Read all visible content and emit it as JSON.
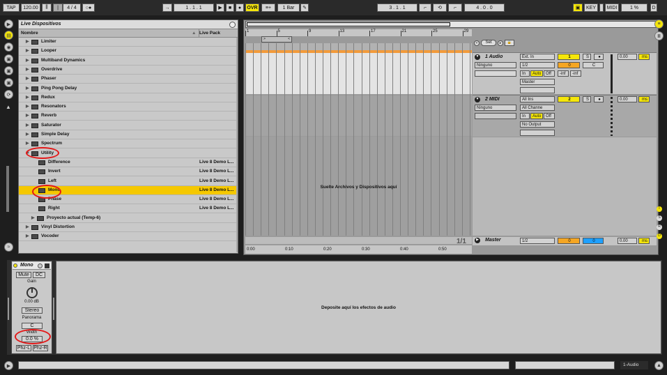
{
  "transport": {
    "tap": "TAP",
    "tempo": "120.00",
    "signature": "4 / 4",
    "arrangement_pos": "1 .  1 .  1",
    "ovr": "OVR",
    "quantize": "1 Bar",
    "loop_start": "3 .  1 .  1",
    "loop_length": "4 .  0 .  0",
    "key": "KEY",
    "midi": "MIDI",
    "cpu": "1 %",
    "disk": "D"
  },
  "browser": {
    "title": "Live Dispositivos",
    "col_name": "Nombre",
    "col_pack": "Live Pack",
    "rows": [
      {
        "name": "Limiter",
        "pack": ""
      },
      {
        "name": "Looper",
        "pack": ""
      },
      {
        "name": "Multiband Dynamics",
        "pack": ""
      },
      {
        "name": "Overdrive",
        "pack": ""
      },
      {
        "name": "Phaser",
        "pack": ""
      },
      {
        "name": "Ping Pong Delay",
        "pack": ""
      },
      {
        "name": "Redux",
        "pack": ""
      },
      {
        "name": "Resonators",
        "pack": ""
      },
      {
        "name": "Reverb",
        "pack": ""
      },
      {
        "name": "Saturator",
        "pack": ""
      },
      {
        "name": "Simple Delay",
        "pack": ""
      },
      {
        "name": "Spectrum",
        "pack": ""
      },
      {
        "name": "Utility",
        "pack": ""
      },
      {
        "name": "Difference",
        "pack": "Live 8 Demo L..."
      },
      {
        "name": "Invert",
        "pack": "Live 8 Demo L..."
      },
      {
        "name": "Left",
        "pack": "Live 8 Demo L..."
      },
      {
        "name": "Mono",
        "pack": "Live 8 Demo L..."
      },
      {
        "name": "Phase",
        "pack": "Live 8 Demo L..."
      },
      {
        "name": "Right",
        "pack": "Live 8 Demo L..."
      },
      {
        "name": "Proyecto actual (Temp-6)",
        "pack": ""
      },
      {
        "name": "Vinyl Distortion",
        "pack": ""
      },
      {
        "name": "Vocoder",
        "pack": ""
      }
    ]
  },
  "arrangement": {
    "bar_numbers": [
      "1",
      "5",
      "9",
      "13",
      "17",
      "21",
      "25",
      "29"
    ],
    "time_labels": [
      "0:00",
      "0:10",
      "0:20",
      "0:30",
      "0:40",
      "0:50"
    ],
    "drop_text": "Suelte Archivos y Dispositivos aquí",
    "zoom_label": "1/1",
    "set_label": "Set"
  },
  "tracks": [
    {
      "name": "1 Audio",
      "input_type": "Ext. In",
      "input_channel": "1/2",
      "routing_left": "Ninguno",
      "output": "Master",
      "number": "1",
      "vol_value": "0",
      "pan": "C",
      "send_a": "-inf",
      "send_b": "-inf",
      "delay": "0.00",
      "delay_unit": "ms",
      "in": "In",
      "auto": "Auto",
      "off": "Off",
      "solo": "S"
    },
    {
      "name": "2 MIDI",
      "input_type": "All Ins",
      "input_channel": "All Channe",
      "routing_left": "Ninguno",
      "output": "No Output",
      "number": "2",
      "delay": "0.00",
      "delay_unit": "ms",
      "in": "In",
      "auto": "Auto",
      "off": "Off",
      "solo": "S"
    }
  ],
  "master": {
    "name": "Master",
    "channel": "1/2",
    "vol_value": "0",
    "pan_value": "0",
    "delay": "0.00",
    "delay_unit": "ms"
  },
  "device": {
    "name": "Mono",
    "mute": "Mute",
    "dc": "DC",
    "gain_label": "Gain",
    "gain_value": "0.00 dB",
    "stereo": "Stereo",
    "panorama_label": "Panorama",
    "panorama_value": "C",
    "width_label": "Width",
    "width_value": "0.0 %",
    "phz_l": "Phz-L",
    "phz_r": "Phz-R"
  },
  "device_drop_text": "Deposite aquí los efectos de audio",
  "status": {
    "track_label": "1-Audio"
  },
  "colors": {
    "selection": "#f5c800",
    "track_number": "#f5e60a",
    "volume": "#f5a623",
    "master_pan": "#1ea0ff",
    "annotation": "#e31919"
  }
}
